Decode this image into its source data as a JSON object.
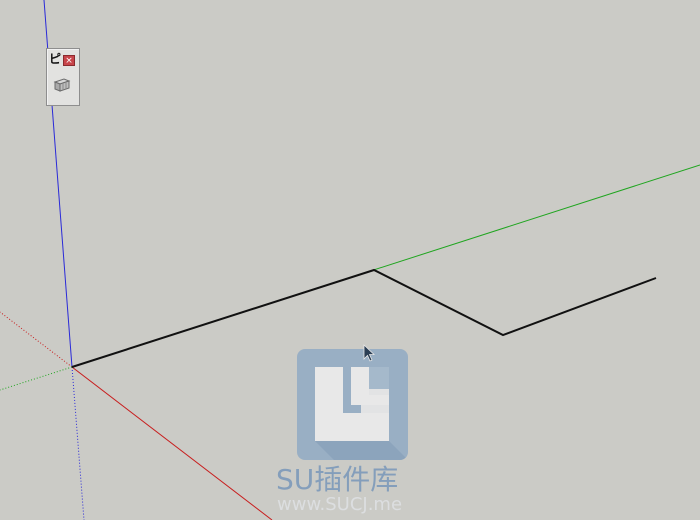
{
  "toolbar": {
    "title_glyph": "ピ",
    "close_glyph": "×",
    "tool_icon": "box-view-icon"
  },
  "viewport": {
    "background": "#cbcbc6",
    "axis_colors": {
      "red": "#c81e1e",
      "green": "#1fa51f",
      "blue": "#2a2ad8"
    },
    "edge_color": "#111111"
  },
  "cursor": {
    "icon": "arrow-cursor-icon"
  },
  "watermark": {
    "text": "SU插件库",
    "url": "www.SUCJ.me",
    "logo_icon": "sucj-logo-icon"
  }
}
